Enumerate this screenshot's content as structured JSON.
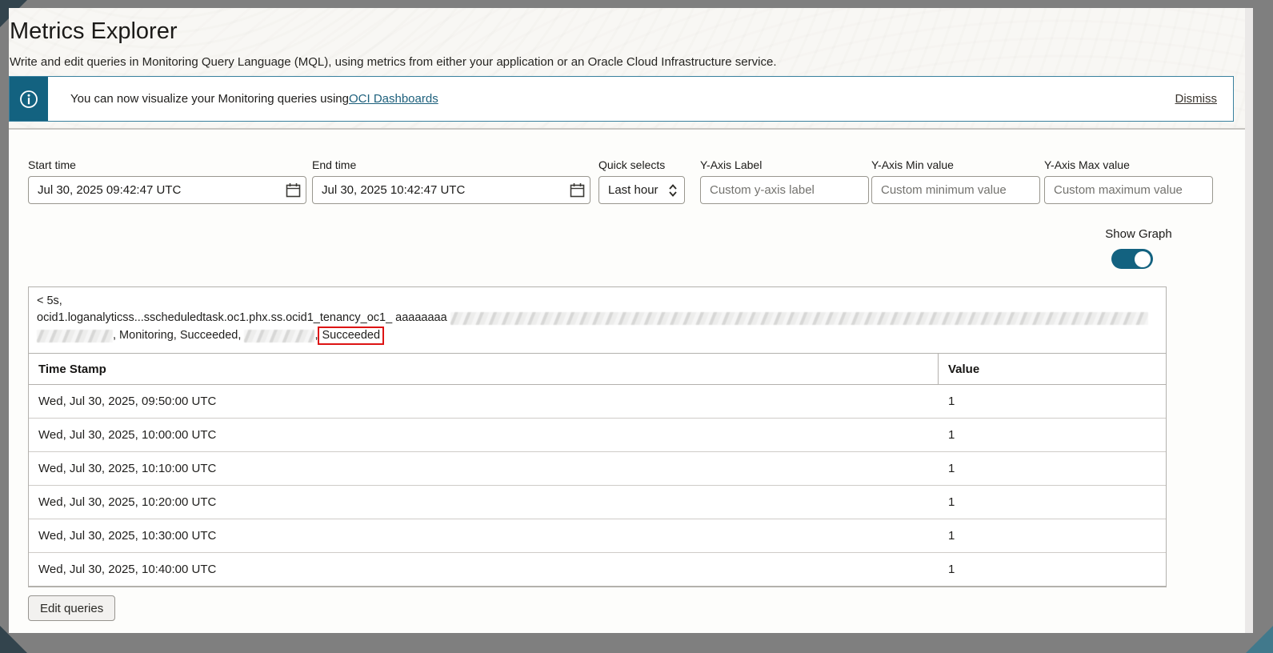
{
  "header": {
    "title": "Metrics Explorer",
    "subtitle": "Write and edit queries in Monitoring Query Language (MQL), using metrics from either your application or an Oracle Cloud Infrastructure service."
  },
  "banner": {
    "icon": "info-circle-icon",
    "message_prefix": "You can now visualize your Monitoring queries using ",
    "link_label": "OCI Dashboards",
    "dismiss_label": "Dismiss"
  },
  "filters": {
    "start_time": {
      "label": "Start time",
      "value": "Jul 30, 2025 09:42:47 UTC",
      "icon": "calendar-icon"
    },
    "end_time": {
      "label": "End time",
      "value": "Jul 30, 2025 10:42:47 UTC",
      "icon": "calendar-icon"
    },
    "quick_selects": {
      "label": "Quick selects",
      "value": "Last hour",
      "icon": "updown-chevrons-icon"
    },
    "y_axis_label": {
      "label": "Y-Axis Label",
      "placeholder": "Custom y-axis label"
    },
    "y_axis_min": {
      "label": "Y-Axis Min value",
      "placeholder": "Custom minimum value"
    },
    "y_axis_max": {
      "label": "Y-Axis Max value",
      "placeholder": "Custom maximum value"
    }
  },
  "show_graph": {
    "label": "Show Graph",
    "state": "on"
  },
  "query_summary": {
    "line1": "< 5s,",
    "line2_text": "ocid1.loganalyticss...sscheduledtask.oc1.phx.ss.ocid1_tenancy_oc1_ aaaaaaaa",
    "line3_text1": ", Monitoring, Succeeded, ",
    "line3_text2": ",",
    "line3_highlight": "Succeeded"
  },
  "table": {
    "columns": [
      "Time Stamp",
      "Value"
    ],
    "rows": [
      {
        "timestamp": "Wed, Jul 30, 2025, 09:50:00 UTC",
        "value": "1"
      },
      {
        "timestamp": "Wed, Jul 30, 2025, 10:00:00 UTC",
        "value": "1"
      },
      {
        "timestamp": "Wed, Jul 30, 2025, 10:10:00 UTC",
        "value": "1"
      },
      {
        "timestamp": "Wed, Jul 30, 2025, 10:20:00 UTC",
        "value": "1"
      },
      {
        "timestamp": "Wed, Jul 30, 2025, 10:30:00 UTC",
        "value": "1"
      },
      {
        "timestamp": "Wed, Jul 30, 2025, 10:40:00 UTC",
        "value": "1"
      }
    ]
  },
  "actions": {
    "edit_queries_label": "Edit queries"
  },
  "colors": {
    "teal": "#136280",
    "link": "#1d607c",
    "highlight_box": "#dd1414",
    "frame": "#7f7f7f"
  }
}
